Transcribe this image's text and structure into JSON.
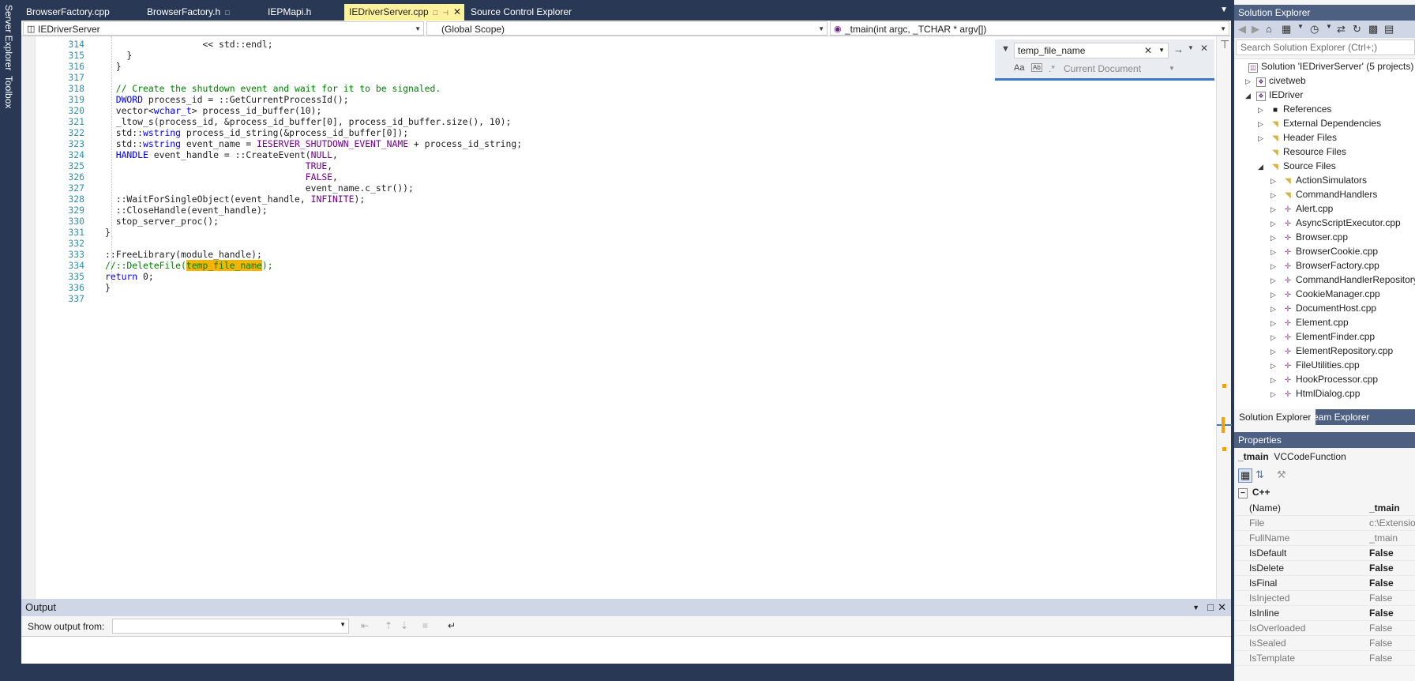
{
  "side_tabs": [
    "Server Explorer",
    "Toolbox"
  ],
  "doc_tabs": [
    {
      "label": "BrowserFactory.cpp"
    },
    {
      "label": "BrowserFactory.h"
    },
    {
      "label": "IEPMapi.h"
    },
    {
      "label": "IEDriverServer.cpp"
    },
    {
      "label": "Source Control Explorer"
    }
  ],
  "nav": {
    "project": "IEDriverServer",
    "scope": "(Global Scope)",
    "member": "_tmain(int argc, _TCHAR * argv[])"
  },
  "code_lines": [
    {
      "n": "314",
      "t": "                  << std::endl;"
    },
    {
      "n": "315",
      "t": "    }"
    },
    {
      "n": "316",
      "t": "  }"
    },
    {
      "n": "317",
      "t": ""
    },
    {
      "n": "318",
      "t": "  // Create the shutdown event and wait for it to be signaled."
    },
    {
      "n": "319",
      "t": "  DWORD process_id = ::GetCurrentProcessId();"
    },
    {
      "n": "320",
      "t": "  vector<wchar_t> process_id_buffer(10);"
    },
    {
      "n": "321",
      "t": "  _ltow_s(process_id, &process_id_buffer[0], process_id_buffer.size(), 10);"
    },
    {
      "n": "322",
      "t": "  std::wstring process_id_string(&process_id_buffer[0]);"
    },
    {
      "n": "323",
      "t": "  std::wstring event_name = IESERVER_SHUTDOWN_EVENT_NAME + process_id_string;"
    },
    {
      "n": "324",
      "t": "  HANDLE event_handle = ::CreateEvent(NULL,"
    },
    {
      "n": "325",
      "t": "                                     TRUE,"
    },
    {
      "n": "326",
      "t": "                                     FALSE,"
    },
    {
      "n": "327",
      "t": "                                     event_name.c_str());"
    },
    {
      "n": "328",
      "t": "  ::WaitForSingleObject(event_handle, INFINITE);"
    },
    {
      "n": "329",
      "t": "  ::CloseHandle(event_handle);"
    },
    {
      "n": "330",
      "t": "  stop_server_proc();"
    },
    {
      "n": "331",
      "t": "}"
    },
    {
      "n": "332",
      "t": ""
    },
    {
      "n": "333",
      "t": "::FreeLibrary(module_handle);"
    },
    {
      "n": "334",
      "t": "//::DeleteFile(temp_file_name);"
    },
    {
      "n": "335",
      "t": "return 0;"
    },
    {
      "n": "336",
      "t": "}"
    },
    {
      "n": "337",
      "t": ""
    }
  ],
  "find": {
    "query": "temp_file_name",
    "scope": "Current Document",
    "match_case": "Aa",
    "whole_word": "Ab"
  },
  "solution_explorer": {
    "title": "Solution Explorer",
    "search_placeholder": "Search Solution Explorer (Ctrl+;)",
    "solution": "Solution 'IEDriverServer' (5 projects)",
    "items": [
      "civetweb",
      "IEDriver",
      "References",
      "External Dependencies",
      "Header Files",
      "Resource Files",
      "Source Files",
      "ActionSimulators",
      "CommandHandlers",
      "Alert.cpp",
      "AsyncScriptExecutor.cpp",
      "Browser.cpp",
      "BrowserCookie.cpp",
      "BrowserFactory.cpp",
      "CommandHandlerRepository.cpp",
      "CookieManager.cpp",
      "DocumentHost.cpp",
      "Element.cpp",
      "ElementFinder.cpp",
      "ElementRepository.cpp",
      "FileUtilities.cpp",
      "HookProcessor.cpp",
      "HtmlDialog.cpp"
    ],
    "bottom_tabs": [
      "Solution Explorer",
      "Team Explorer"
    ]
  },
  "properties": {
    "title": "Properties",
    "object_name": "_tmain",
    "object_type": "VCCodeFunction",
    "category": "C++",
    "rows": [
      {
        "name": "(Name)",
        "value": "_tmain"
      },
      {
        "name": "File",
        "value": "c:\\Extensions"
      },
      {
        "name": "FullName",
        "value": "_tmain"
      },
      {
        "name": "IsDefault",
        "value": "False"
      },
      {
        "name": "IsDelete",
        "value": "False"
      },
      {
        "name": "IsFinal",
        "value": "False"
      },
      {
        "name": "IsInjected",
        "value": "False"
      },
      {
        "name": "IsInline",
        "value": "False"
      },
      {
        "name": "IsOverloaded",
        "value": "False"
      },
      {
        "name": "IsSealed",
        "value": "False"
      },
      {
        "name": "IsTemplate",
        "value": "False"
      }
    ]
  },
  "output": {
    "title": "Output",
    "show_from_label": "Show output from:",
    "show_from_value": ""
  }
}
